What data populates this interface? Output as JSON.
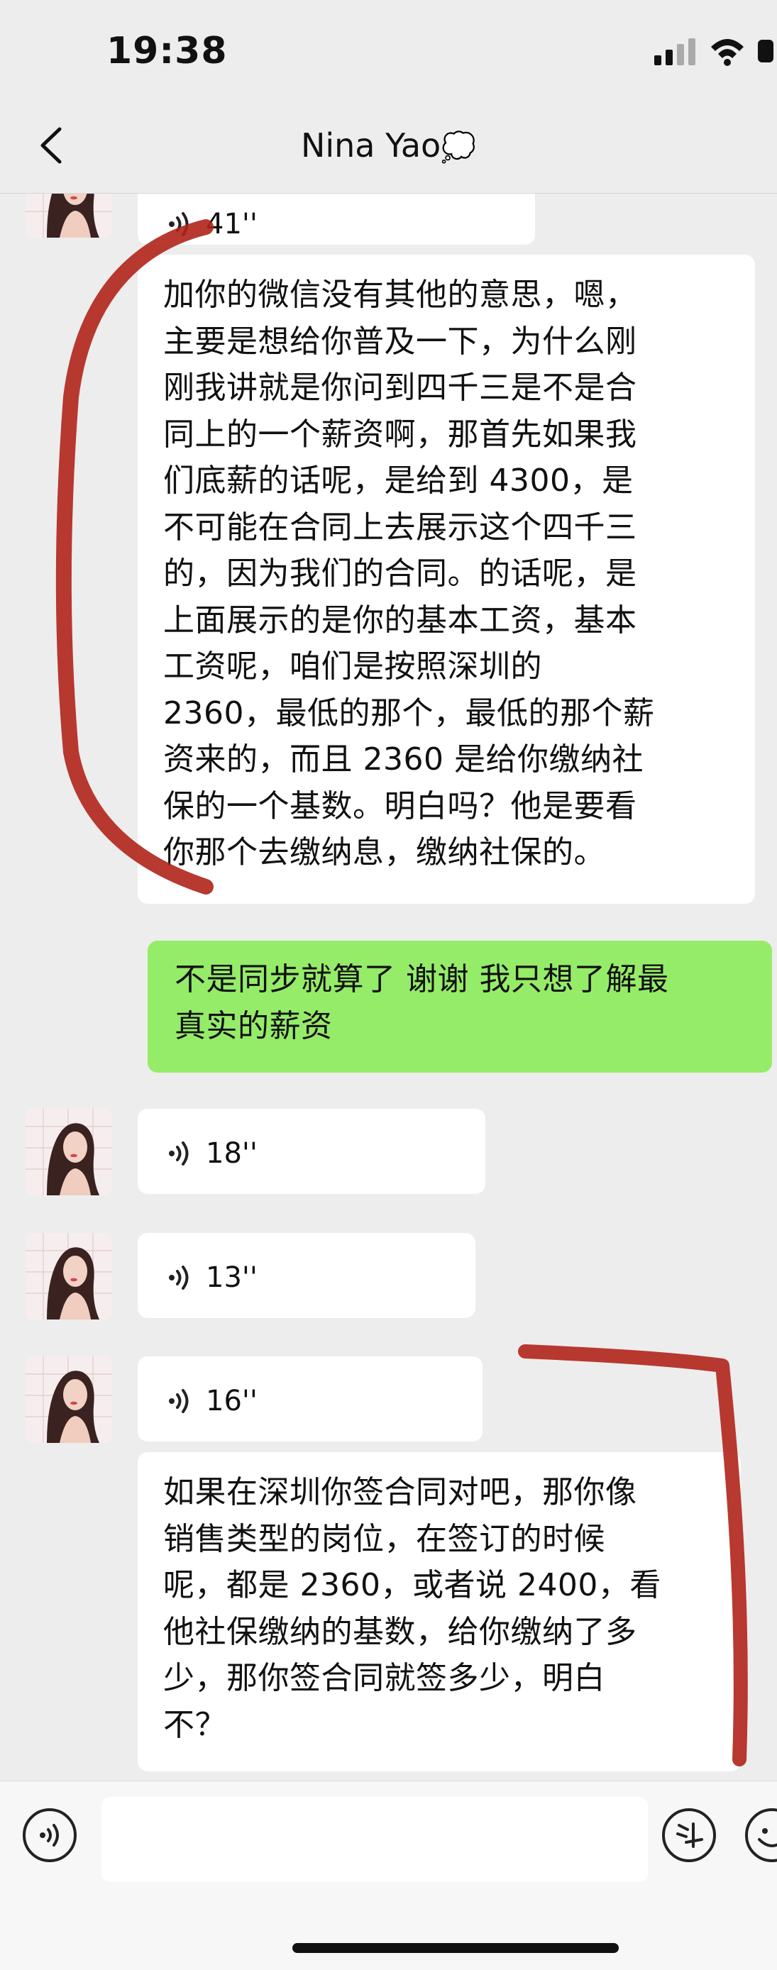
{
  "status_bar": {
    "time": "19:38"
  },
  "header": {
    "title": "Nina Yao",
    "title_emoji": "💭"
  },
  "messages": [
    {
      "type": "voice",
      "direction": "in",
      "duration": "41''"
    },
    {
      "type": "text",
      "direction": "in",
      "lines": [
        "加你的微信没有其他的意思，嗯，",
        "主要是想给你普及一下，为什么刚",
        "刚我讲就是你问到四千三是不是合",
        "同上的一个薪资啊，那首先如果我",
        "们底薪的话呢，是给到 4300，是",
        "不可能在合同上去展示这个四千三",
        "的，因为我们的合同。的话呢，是",
        "上面展示的是你的基本工资，基本",
        "工资呢，咱们是按照深圳的",
        "2360，最低的那个，最低的那个薪",
        "资来的，而且 2360 是给你缴纳社",
        "保的一个基数。明白吗？他是要看",
        "你那个去缴纳息，缴纳社保的。"
      ]
    },
    {
      "type": "text",
      "direction": "out",
      "lines": [
        "不是同步就算了 谢谢 我只想了解最",
        "真实的薪资"
      ]
    },
    {
      "type": "voice",
      "direction": "in",
      "duration": "18''"
    },
    {
      "type": "voice",
      "direction": "in",
      "duration": "13''"
    },
    {
      "type": "voice",
      "direction": "in",
      "duration": "16''"
    },
    {
      "type": "text",
      "direction": "in",
      "lines": [
        "如果在深圳你签合同对吧，那你像",
        "销售类型的岗位，在签订的时候",
        "呢，都是 2360，或者说 2400，看",
        "他社保缴纳的基数，给你缴纳了多",
        "少，那你签合同就签多少，明白",
        "不？"
      ]
    }
  ],
  "colors": {
    "background": "#ededed",
    "incoming_bubble": "#ffffff",
    "outgoing_bubble": "#95ec69",
    "annotation_stroke": "#b0231a"
  },
  "icons": {
    "back": "chevron-left-icon",
    "voice_mode": "voice-icon",
    "sticker": "sticker-icon",
    "emoji": "emoji-icon",
    "voice_wave": "voice-wave-icon"
  }
}
